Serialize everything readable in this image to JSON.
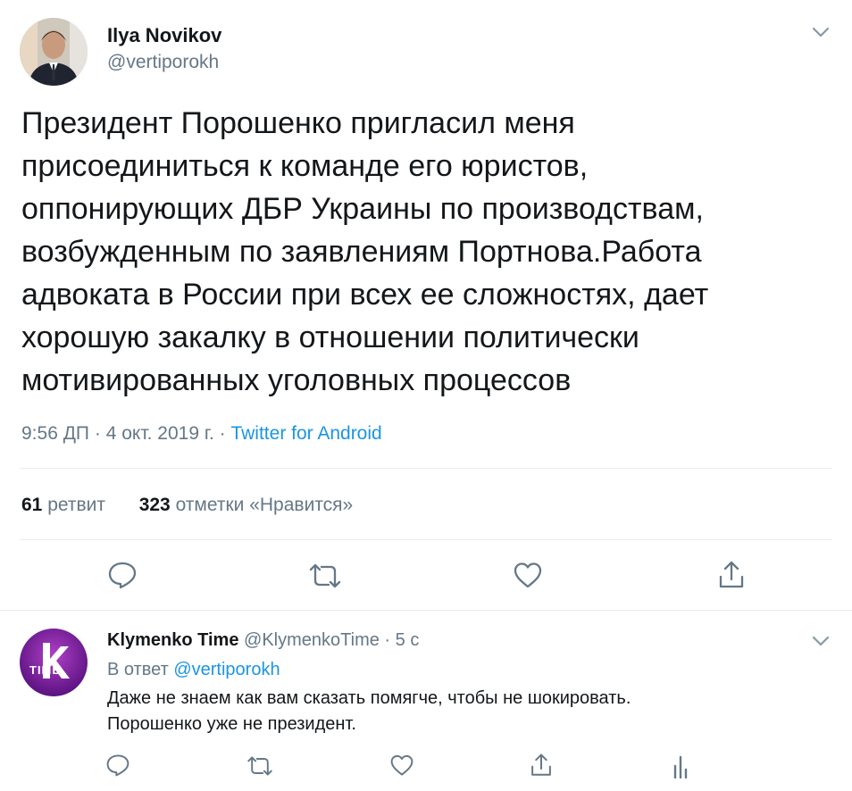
{
  "tweet": {
    "author_name": "Ilya Novikov",
    "author_handle": "@vertiporokh",
    "text_lines": [
      "Президент Порошенко пригласил меня",
      "присоединиться к команде его юристов,",
      "оппонирующих ДБР Украины по производствам,",
      "возбужденным по заявлениям Портнова.Работа",
      "адвоката в России при всех ее сложностях, дает",
      "хорошую закалку в отношении политически",
      "мотивированных уголовных процессов"
    ],
    "time": "9:56 ДП",
    "date": "4 окт. 2019 г.",
    "sep": "·",
    "source": "Twitter for Android",
    "retweet_count": "61",
    "retweet_label": "ретвит",
    "like_count": "323",
    "like_label": "отметки «Нравится»"
  },
  "reply": {
    "author_name": "Klymenko Time",
    "author_handle": "@KlymenkoTime",
    "sep": "·",
    "age": "5 с",
    "reply_to_prefix": "В ответ",
    "reply_to_handle": "@vertiporokh",
    "text_lines": [
      "Даже не знаем как вам сказать помягче, чтобы не шокировать.",
      "Порошенко уже не президент."
    ],
    "avatar_text": "TIME"
  },
  "colors": {
    "accent": "#1b95e0",
    "gray": "#657786",
    "divider": "#e6ecf0",
    "reply_avatar_bg": "#7a1fa2"
  }
}
